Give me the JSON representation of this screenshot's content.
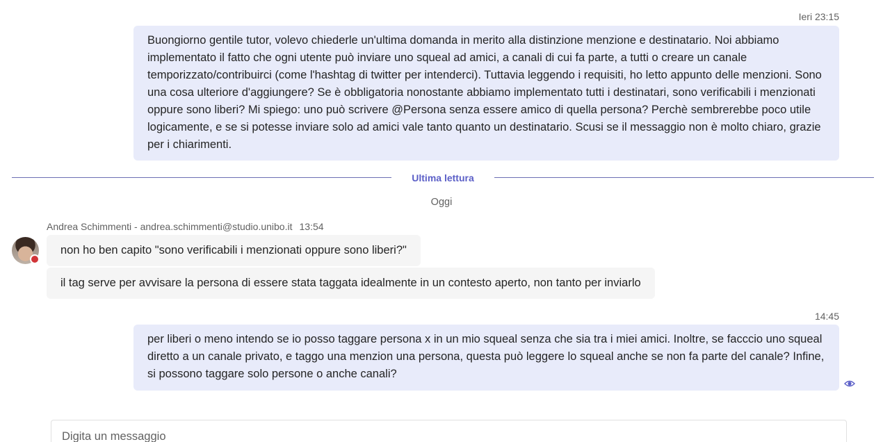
{
  "messages": {
    "first": {
      "time": "Ieri 23:15",
      "text": "Buongiorno gentile tutor, volevo chiederle un'ultima domanda in merito alla distinzione menzione e destinatario. Noi abbiamo implementato il fatto che ogni utente può inviare uno squeal ad amici, a canali di cui fa parte, a tutti o creare un canale temporizzato/contribuirci (come  l'hashtag di twitter per intenderci). Tuttavia leggendo i requisiti, ho letto appunto delle menzioni. Sono una cosa ulteriore d'aggiungere? Se è obbligatoria nonostante abbiamo implementato tutti i destinatari, sono verificabili i menzionati oppure sono liberi? Mi spiego: uno può scrivere @Persona senza essere amico di quella persona? Perchè sembrerebbe poco utile logicamente, e se si potesse inviare solo ad amici vale tanto quanto un destinatario. Scusi se il messaggio non è molto chiaro, grazie per i chiarimenti."
    },
    "divider_label": "Ultima lettura",
    "day_label": "Oggi",
    "reply": {
      "sender": "Andrea Schimmenti - andrea.schimmenti@studio.unibo.it",
      "time": "13:54",
      "line1": "non ho ben capito \"sono verificabili i menzionati oppure sono liberi?\"",
      "line2": "il tag serve per avvisare la persona di essere stata taggata idealmente in un contesto aperto, non tanto per inviarlo"
    },
    "last": {
      "time": "14:45",
      "text": "per liberi o meno intendo se io posso taggare persona x in un mio squeal senza che sia tra i miei amici. Inoltre, se facccio uno squeal diretto a un canale privato, e taggo una menzion una persona, questa può leggere lo squeal anche se non fa parte del canale? Infine, si possono taggare solo persone o anche canali?"
    }
  },
  "composer": {
    "placeholder": "Digita un messaggio",
    "value": ""
  },
  "icons": {
    "seen": "eye-icon",
    "presence": "busy-status-dot"
  },
  "colors": {
    "outgoing_bubble": "#e8ebfa",
    "incoming_bubble": "#f5f5f5",
    "accent": "#5b5fc7",
    "presence_busy": "#d13438"
  }
}
